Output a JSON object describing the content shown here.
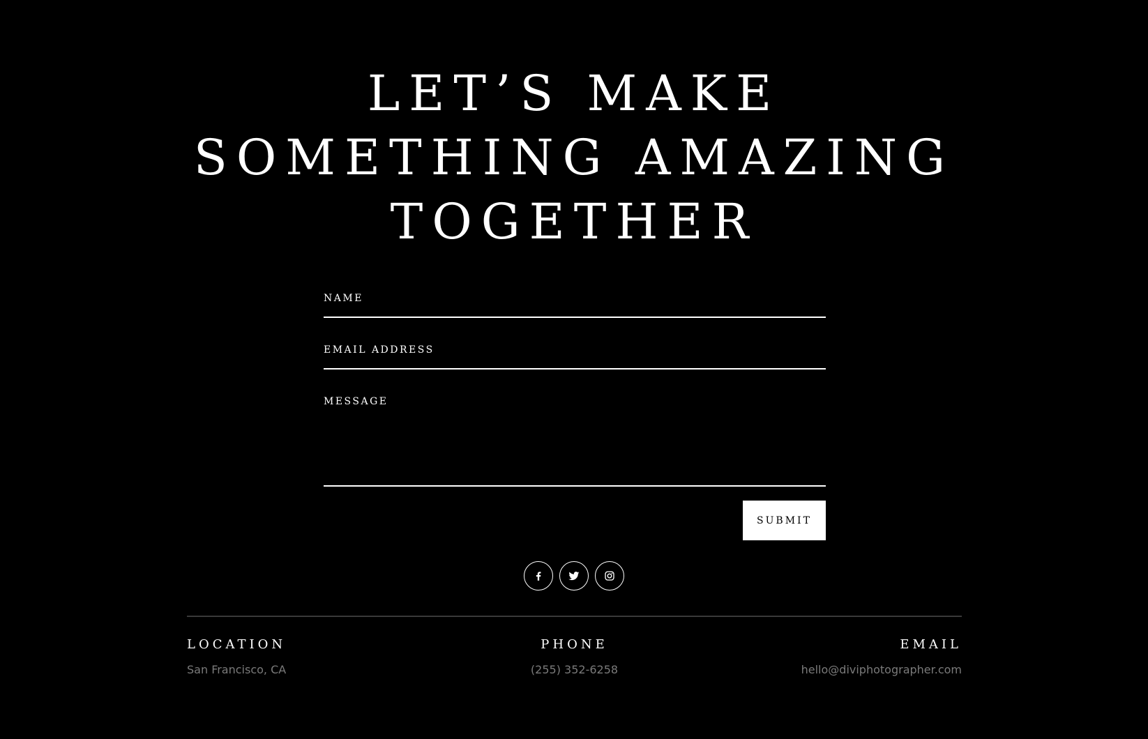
{
  "headline": {
    "lines": [
      "LET’S MAKE",
      "SOMETHING AMAZING",
      "TOGETHER"
    ]
  },
  "form": {
    "name_label": "NAME",
    "email_label": "EMAIL ADDRESS",
    "message_label": "MESSAGE",
    "name_value": "",
    "email_value": "",
    "message_value": "",
    "submit_label": "SUBMIT"
  },
  "social": {
    "icons": [
      "facebook-icon",
      "twitter-icon",
      "instagram-icon"
    ]
  },
  "contact_info": {
    "location": {
      "label": "LOCATION",
      "value": "San Francisco, CA"
    },
    "phone": {
      "label": "PHONE",
      "value": "(255) 352-6258"
    },
    "email": {
      "label": "EMAIL",
      "value": "hello@diviphotographer.com"
    }
  },
  "colors": {
    "background": "#000000",
    "text": "#ffffff",
    "muted_text": "#7a7a7a",
    "divider": "#3a3a3a"
  }
}
